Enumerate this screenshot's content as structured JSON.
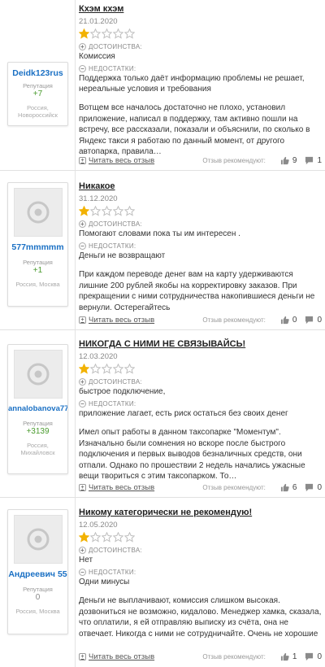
{
  "labels": {
    "pros": "ДОСТОИНСТВА:",
    "cons": "НЕДОСТАТКИ:",
    "reputation": "Репутация",
    "read_more": "Читать весь отзыв",
    "recommend": "Отзыв рекомендуют:"
  },
  "colors": {
    "star_filled": "#f2b203",
    "star_empty": "#bfbfbf",
    "link": "#1a70c4",
    "positive": "#4a9b2e"
  },
  "reviews": [
    {
      "title": "Кхэм кхэм",
      "date": "21.01.2020",
      "rating": 1,
      "max_rating": 5,
      "user": {
        "name": "Deidk123rus",
        "reputation": "+7",
        "location": "Россия, Новороссийск"
      },
      "pros": "Комиссия",
      "cons": "Поддержка только даёт информацию проблемы не решает, нереальные условия и требования",
      "text": "Вотщем все началось достаточно не плохо, установил приложение, написал в поддержку, там активно пошли на встречу, все рассказали, показали и объяснили, по сколько в Яндекс такси я работаю по данный момент, от другого автопарка, правила…",
      "likes": "9",
      "comments": "1"
    },
    {
      "title": "Никакое",
      "date": "31.12.2020",
      "rating": 1,
      "max_rating": 5,
      "user": {
        "name": "577mmmmm",
        "reputation": "+1",
        "location": "Россия, Москва"
      },
      "pros": "Помогают словами пока ты им интересен .",
      "cons": "Деньги не возвращают",
      "text": "При каждом переводе денег вам на карту удерживаются лишние 200 рублей якобы на корректировку заказов. При прекращении с ними сотрудничества накопившиеся деньги не вернули. Остерегайтесь",
      "likes": "0",
      "comments": "0"
    },
    {
      "title": "НИКОГДА С НИМИ НЕ СВЯЗЫВАЙСЬ!",
      "date": "12.03.2020",
      "rating": 1,
      "max_rating": 5,
      "user": {
        "name": "annalobanova77",
        "reputation": "+3139",
        "location": "Россия, Михайловск"
      },
      "pros": "быстрое подключение,",
      "cons": "приложение лагает, есть риск остаться без своих денег",
      "text": "Имел опыт работы в данном таксопарке \"Моментум\". Изначально были сомнения но вскоре после быстрого подключения и первых выводов безналичных средств, они отпали. Однако по прошествии 2 недель начались ужасные вещи твориться с этим таксопарком. То…",
      "likes": "6",
      "comments": "0"
    },
    {
      "title": "Никому категорически не рекомендую!",
      "date": "12.05.2020",
      "rating": 1,
      "max_rating": 5,
      "user": {
        "name": "Андреевич 55",
        "reputation": "0",
        "location": "Россия, Москва"
      },
      "pros": "Нет",
      "cons": "Одни минусы",
      "text": "Деньги не выплачивают, комиссия слишком высокая. дозвониться не возможно, кидалово. Менеджер хамка, сказала, что оплатили, я ей отправляю выписку из счёта, она не отвечает. Никогда с ними не сотрудничайте. Очень не хорошие",
      "likes": "1",
      "comments": "0"
    }
  ]
}
